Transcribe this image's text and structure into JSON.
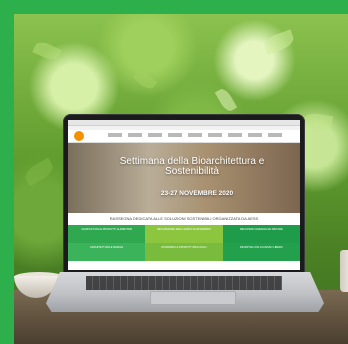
{
  "colors": {
    "frame": "#2db04b",
    "cell_a": "#2fa84f",
    "cell_b": "#8cc63f",
    "cell_c": "#1e9c4a"
  },
  "website": {
    "hero_title": "Settimana della Bioarchitettura e Sostenibilità",
    "hero_date": "23-27 NOVEMBRE 2020",
    "tagline": "RASSEGNA DEDICATA ALLE SOLUZIONI SOSTENIBILI ORGANIZZATA DA AESS",
    "cells": [
      "AGRICOLTURA E PRODOTTI ALIMENTARI",
      "RECUPERARE DEGLI EDIFICI E RISPARMIO",
      "RECUPERO ENERGIA ED ABITARE",
      "ARCHITETTURA E DESIGN",
      "RISPARMIO E PRODOTTI BIOLOGICI",
      "INIZIATIVE CON ACCESSO LIBERO"
    ]
  }
}
